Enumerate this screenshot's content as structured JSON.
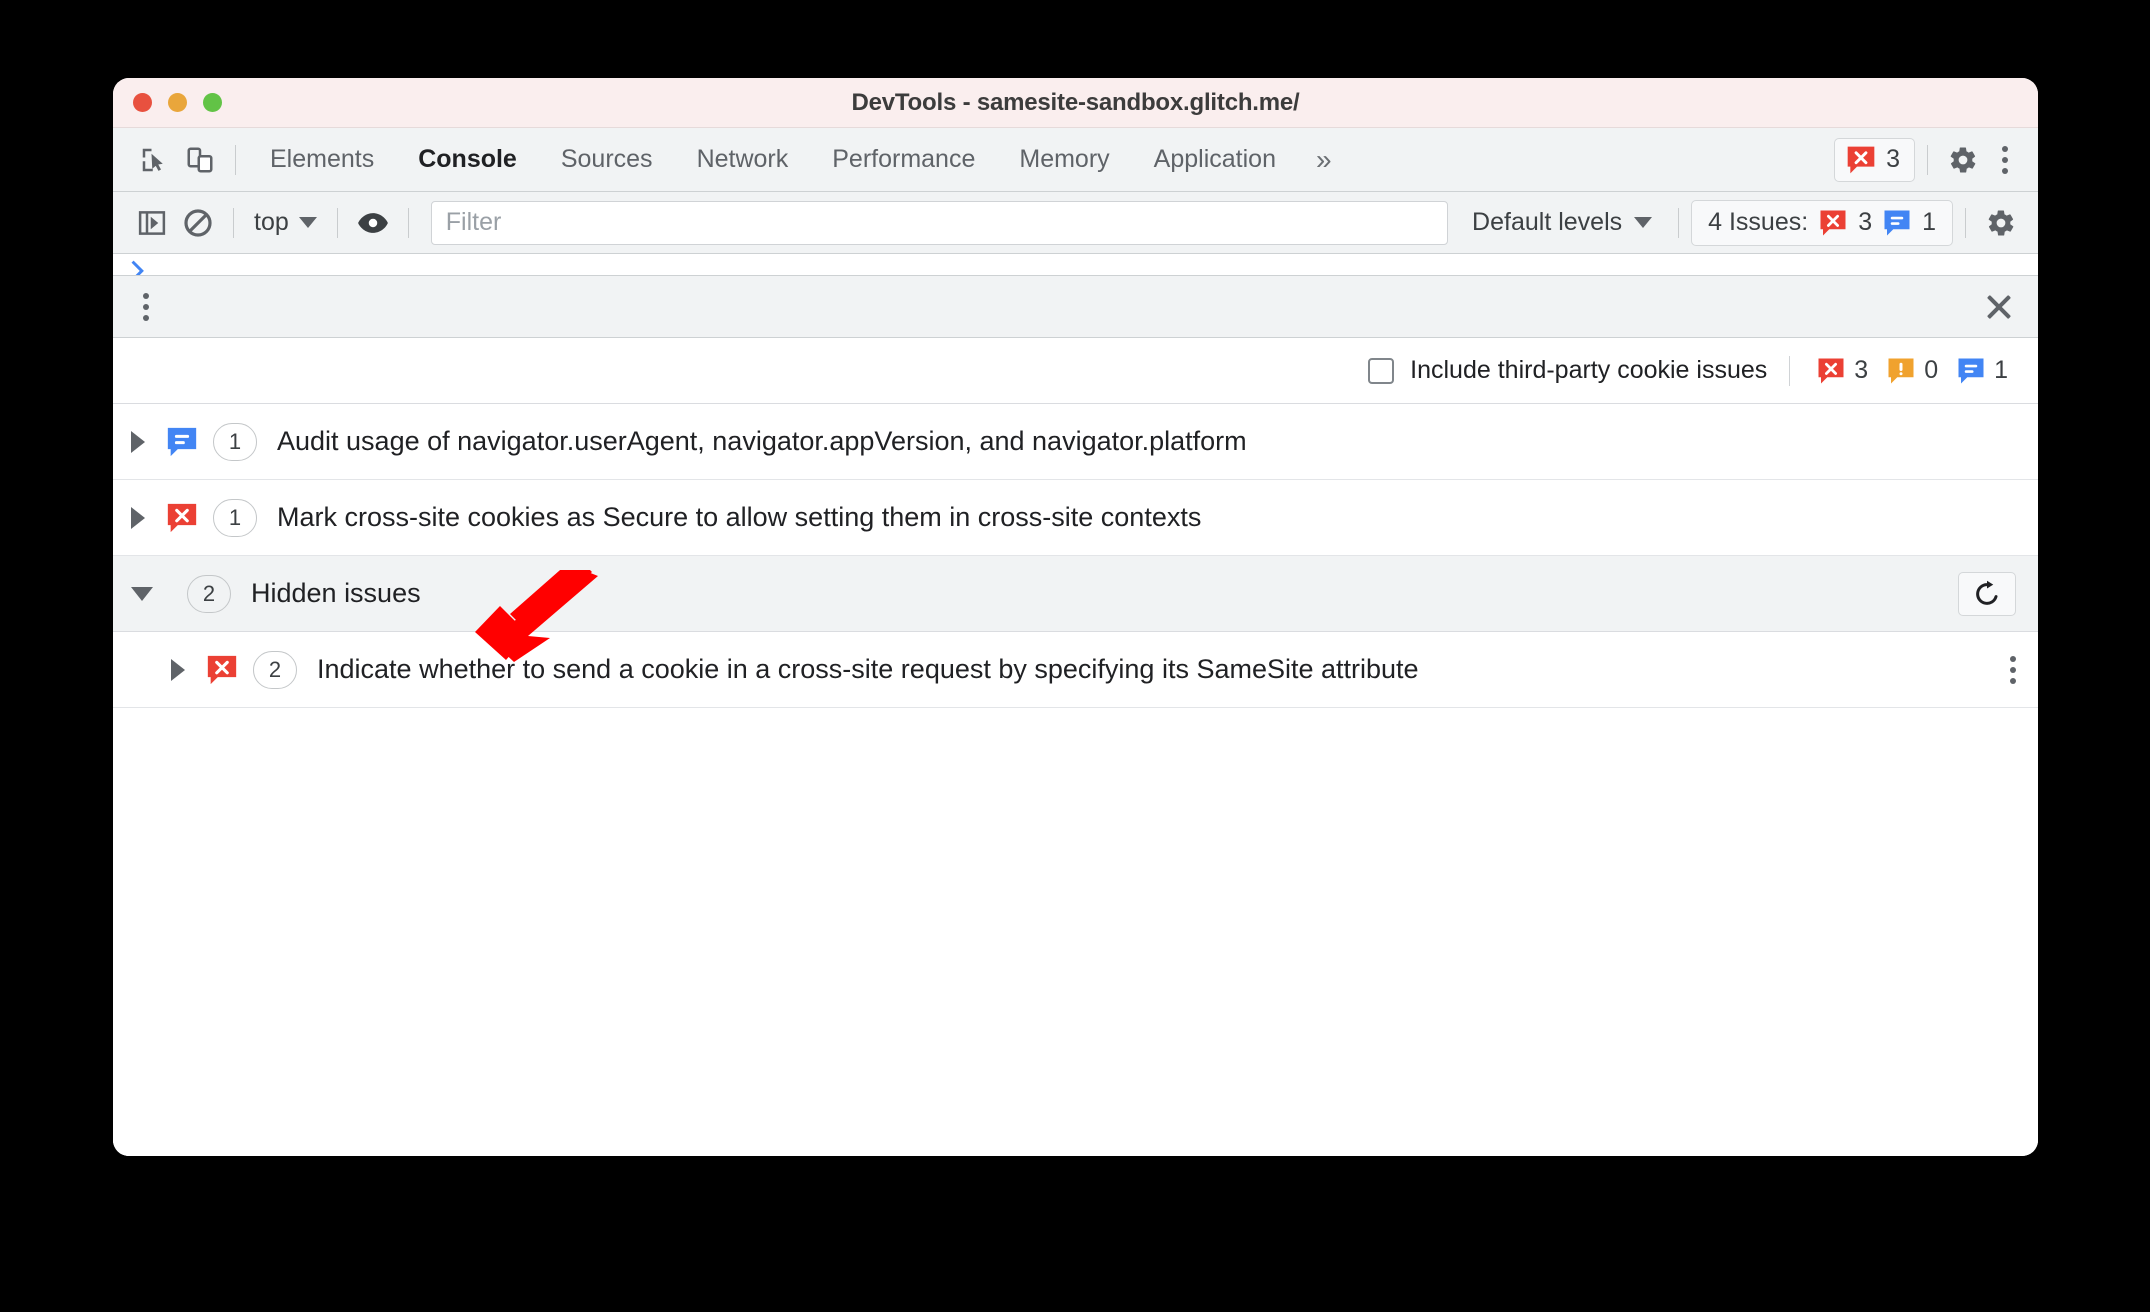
{
  "window": {
    "title": "DevTools - samesite-sandbox.glitch.me/",
    "traffic_lights": [
      "close-red",
      "minimize-yellow",
      "maximize-green"
    ],
    "colors": {
      "titlebar_bg": "#faeeee",
      "toolbar_bg": "#f1f3f4",
      "error_red": "#eb4034",
      "info_blue": "#4285f4",
      "warning_orange": "#f0a22e",
      "annotation_red": "#ff0000"
    }
  },
  "tabstrip": {
    "inspect_icon": "inspect-element-icon",
    "device_icon": "device-toolbar-icon",
    "tabs": [
      {
        "label": "Elements",
        "active": false
      },
      {
        "label": "Console",
        "active": true
      },
      {
        "label": "Sources",
        "active": false
      },
      {
        "label": "Network",
        "active": false
      },
      {
        "label": "Performance",
        "active": false
      },
      {
        "label": "Memory",
        "active": false
      },
      {
        "label": "Application",
        "active": false
      }
    ],
    "more_tabs": "»",
    "error_badge": {
      "icon": "error-icon",
      "count": "3"
    },
    "settings_icon": "gear-icon",
    "menu_icon": "kebab-menu-icon"
  },
  "console_toolbar": {
    "sidebar_toggle_icon": "console-sidebar-icon",
    "clear_icon": "clear-console-icon",
    "context": "top",
    "eye_icon": "live-expression-icon",
    "filter_placeholder": "Filter",
    "filter_value": "",
    "levels": "Default levels",
    "issues_label": "4 Issues:",
    "issues_error_count": "3",
    "issues_info_count": "1",
    "settings_icon": "gear-icon"
  },
  "issues_panel": {
    "menu_icon": "kebab-menu-icon",
    "close_icon": "close-icon",
    "third_party_label": "Include third-party cookie issues",
    "third_party_checked": false,
    "counts": {
      "errors": "3",
      "warnings": "0",
      "info": "1"
    },
    "rows": [
      {
        "kind": "info",
        "expanded": false,
        "count": "1",
        "text": "Audit usage of navigator.userAgent, navigator.appVersion, and navigator.platform",
        "has_kebab": false
      },
      {
        "kind": "error",
        "expanded": false,
        "count": "1",
        "text": "Mark cross-site cookies as Secure to allow setting them in cross-site contexts",
        "has_kebab": false
      }
    ],
    "hidden_group": {
      "expanded": true,
      "count": "2",
      "label": "Hidden issues",
      "restore_icon": "refresh-icon",
      "children": [
        {
          "kind": "error",
          "expanded": false,
          "count": "2",
          "text": "Indicate whether to send a cookie in a cross-site request by specifying its SameSite attribute",
          "has_kebab": true
        }
      ]
    }
  },
  "annotation": {
    "type": "arrow",
    "direction": "down-left",
    "color": "#ff0000",
    "points_at": "hidden-issues-group-row"
  }
}
